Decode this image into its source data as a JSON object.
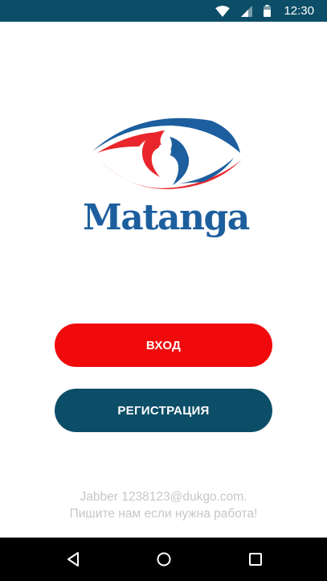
{
  "status_bar": {
    "time": "12:30",
    "icons": [
      "wifi-icon",
      "cell-signal-icon",
      "battery-icon"
    ],
    "background": "#0c4e67"
  },
  "logo": {
    "wordmark": "Matanga",
    "colors": {
      "red": "#e8262b",
      "blue": "#1d5f9e"
    }
  },
  "buttons": {
    "login_label": "ВХОД",
    "register_label": "РЕГИСТРАЦИЯ",
    "login_color": "#f00a0b",
    "register_color": "#0c4e67"
  },
  "footer": {
    "line1": "Jabber 1238123@dukgo.com.",
    "line2": "Пишите нам если нужна работа!"
  },
  "nav_bar": {
    "icons": [
      "back-icon",
      "home-icon",
      "recent-apps-icon"
    ]
  }
}
